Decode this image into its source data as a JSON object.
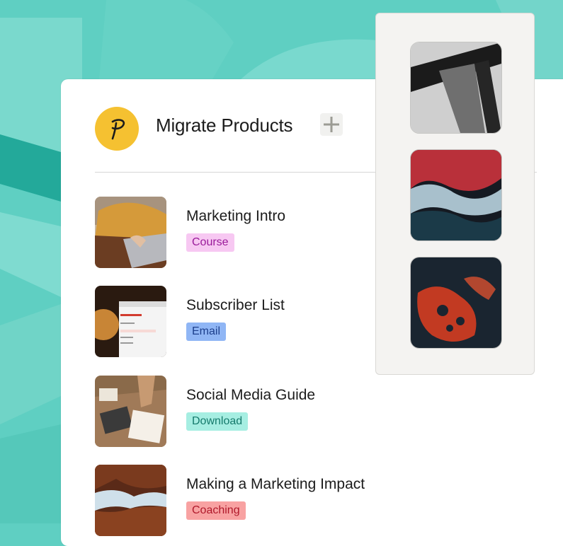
{
  "header": {
    "title": "Migrate Products"
  },
  "products": [
    {
      "title": "Marketing Intro",
      "tag": "Course",
      "tag_bg": "#f7c8f2",
      "tag_color": "#9a1a9a"
    },
    {
      "title": "Subscriber List",
      "tag": "Email",
      "tag_bg": "#90b6f5",
      "tag_color": "#1d3f8c"
    },
    {
      "title": "Social Media Guide",
      "tag": "Download",
      "tag_bg": "#a6eee2",
      "tag_color": "#157a6c"
    },
    {
      "title": "Making a Marketing Impact",
      "tag": "Coaching",
      "tag_bg": "#f8a2a2",
      "tag_color": "#b0192b"
    }
  ],
  "colors": {
    "background_teal": "#5fcfc2",
    "logo_yellow": "#f5c131"
  },
  "icons": {
    "logo": "podia-p-logo",
    "add": "plus-icon"
  }
}
